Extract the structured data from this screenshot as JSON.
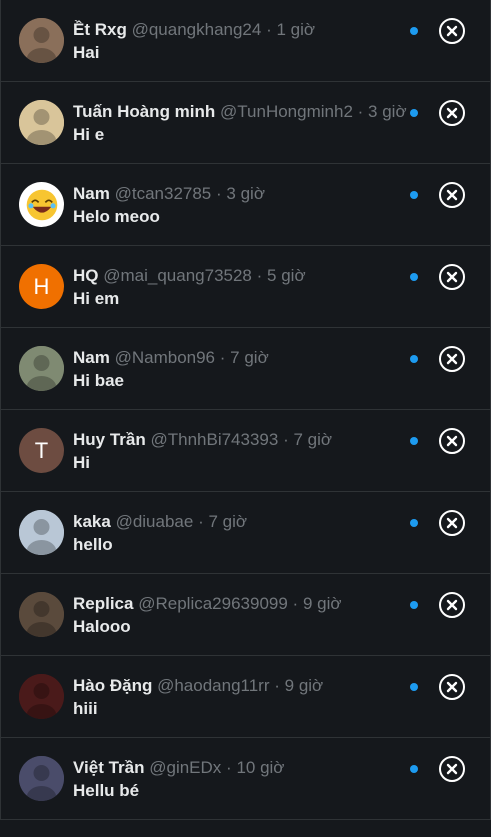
{
  "colors": {
    "background": "#15181c",
    "accent_dot": "#1d9bf0",
    "divider": "#2f3336"
  },
  "notifications": [
    {
      "name": "Ềt Rxg",
      "handle": "@quangkhang24",
      "time": "1 giờ",
      "message": "Hai",
      "avatar": "photo-shirtless",
      "avatar_color": "#8a6f5a"
    },
    {
      "name": "Tuấn Hoàng minh",
      "handle": "@TunHongminh2",
      "time": "3 giờ",
      "message": "Hi e",
      "avatar": "photo-glasses",
      "avatar_color": "#d9c59a"
    },
    {
      "name": "Nam",
      "handle": "@tcan32785",
      "time": "3 giờ",
      "message": "Helo meoo",
      "avatar": "laughing-emoji",
      "avatar_color": "#ffffff"
    },
    {
      "name": "HQ",
      "handle": "@mai_quang73528",
      "time": "5 giờ",
      "message": "Hi em",
      "avatar_letter": "H",
      "avatar_color": "#f07000"
    },
    {
      "name": "Nam",
      "handle": "@Nambon96",
      "time": "7 giờ",
      "message": "Hi bae",
      "avatar": "photo-man",
      "avatar_color": "#7f8a72"
    },
    {
      "name": "Huy Trần",
      "handle": "@ThnhBi743393",
      "time": "7 giờ",
      "message": "Hi",
      "avatar_letter": "T",
      "avatar_color": "#6d4c41"
    },
    {
      "name": "kaka",
      "handle": "@diuabae",
      "time": "7 giờ",
      "message": "hello",
      "avatar": "photo-tree-sky",
      "avatar_color": "#b9c7d6"
    },
    {
      "name": "Replica",
      "handle": "@Replica29639099",
      "time": "9 giờ",
      "message": "Halooo",
      "avatar": "photo-baby",
      "avatar_color": "#5a4a3c"
    },
    {
      "name": "Hào Đặng",
      "handle": "@haodang11rr",
      "time": "9 giờ",
      "message": "hiii",
      "avatar": "photo-dark-red",
      "avatar_color": "#4a1a1a"
    },
    {
      "name": "Việt Trần",
      "handle": "@ginEDx",
      "time": "10 giờ",
      "message": "Hellu bé",
      "avatar": "photo-pc-setup",
      "avatar_color": "#4a4c6a"
    }
  ]
}
